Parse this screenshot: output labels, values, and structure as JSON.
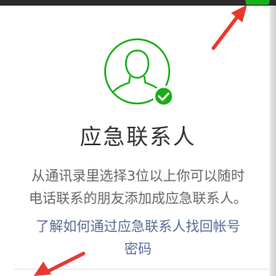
{
  "dialog": {
    "title": "应急联系人",
    "description_lines": [
      "从通讯录里选择3位以上你可以随时",
      "电话联系的朋友添加成应急联系人。"
    ],
    "help_link_lines": [
      "了解如何通过应急联系人找回帐号",
      "密码"
    ]
  },
  "icons": {
    "avatar": "person-avatar-with-check-icon",
    "annotation_arrows": "red-arrow-icon"
  },
  "colors": {
    "accent_green": "#1aad19",
    "link_blue": "#576b95",
    "arrow_red": "#e8392f",
    "title_text": "#333333",
    "body_text": "#666666"
  }
}
